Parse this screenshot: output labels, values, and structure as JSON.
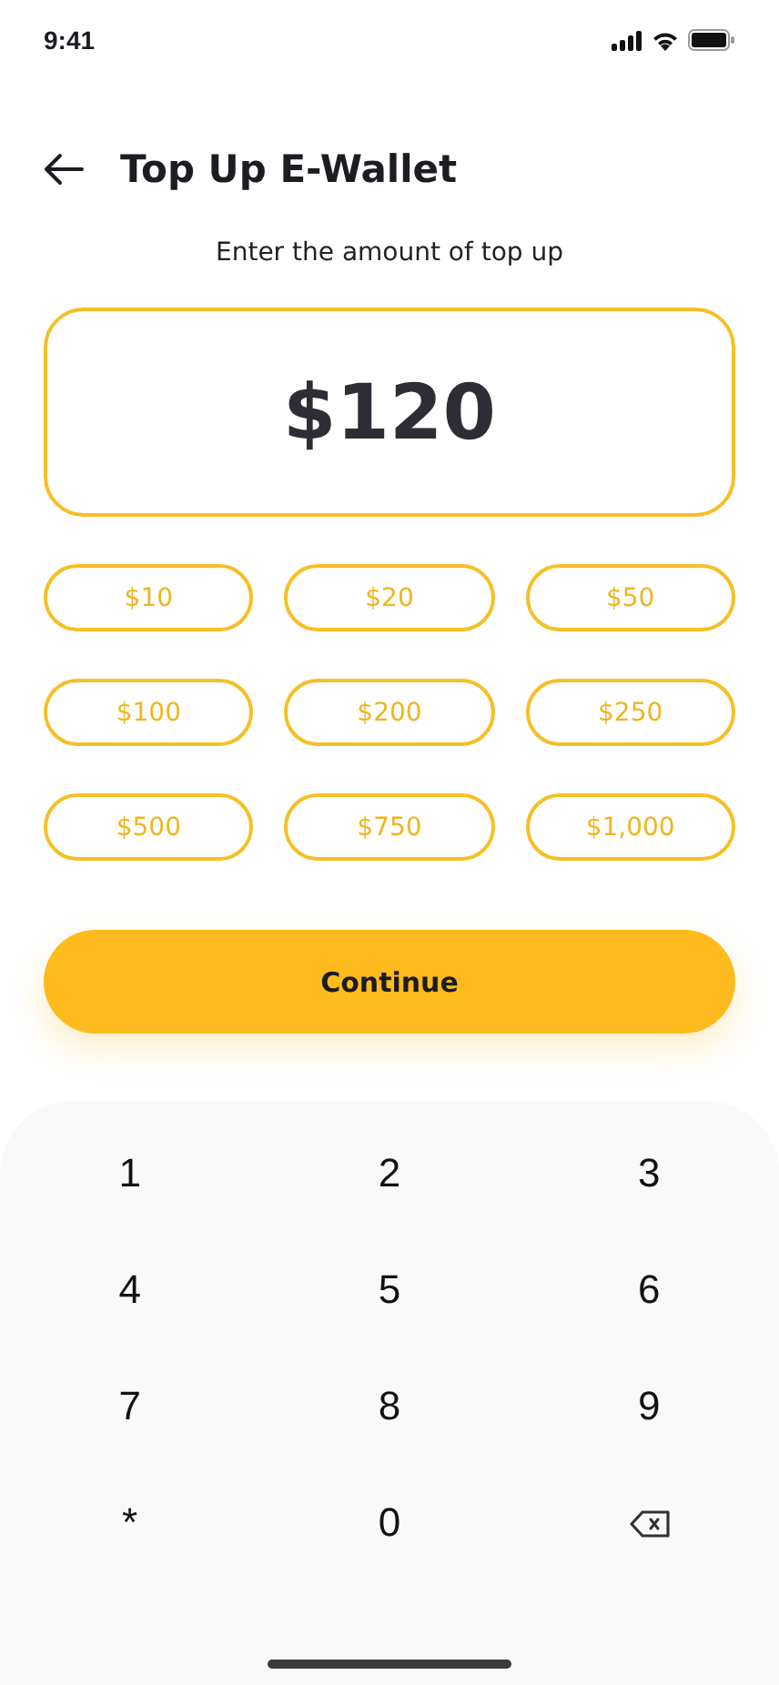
{
  "status_bar": {
    "time": "9:41"
  },
  "header": {
    "title": "Top Up E-Wallet"
  },
  "prompt": "Enter the amount of top up",
  "amount": {
    "value": "$120"
  },
  "presets": [
    {
      "label": "$10",
      "selected": false
    },
    {
      "label": "$20",
      "selected": false
    },
    {
      "label": "$50",
      "selected": false
    },
    {
      "label": "$100",
      "selected": false
    },
    {
      "label": "$200",
      "selected": false
    },
    {
      "label": "$250",
      "selected": false
    },
    {
      "label": "$500",
      "selected": false
    },
    {
      "label": "$750",
      "selected": false
    },
    {
      "label": "$1,000",
      "selected": false
    }
  ],
  "continue_button": "Continue",
  "keypad": [
    {
      "kind": "digit",
      "label": "1"
    },
    {
      "kind": "digit",
      "label": "2"
    },
    {
      "kind": "digit",
      "label": "3"
    },
    {
      "kind": "digit",
      "label": "4"
    },
    {
      "kind": "digit",
      "label": "5"
    },
    {
      "kind": "digit",
      "label": "6"
    },
    {
      "kind": "digit",
      "label": "7"
    },
    {
      "kind": "digit",
      "label": "8"
    },
    {
      "kind": "digit",
      "label": "9"
    },
    {
      "kind": "digit",
      "label": "*"
    },
    {
      "kind": "digit",
      "label": "0"
    },
    {
      "kind": "backspace"
    }
  ]
}
